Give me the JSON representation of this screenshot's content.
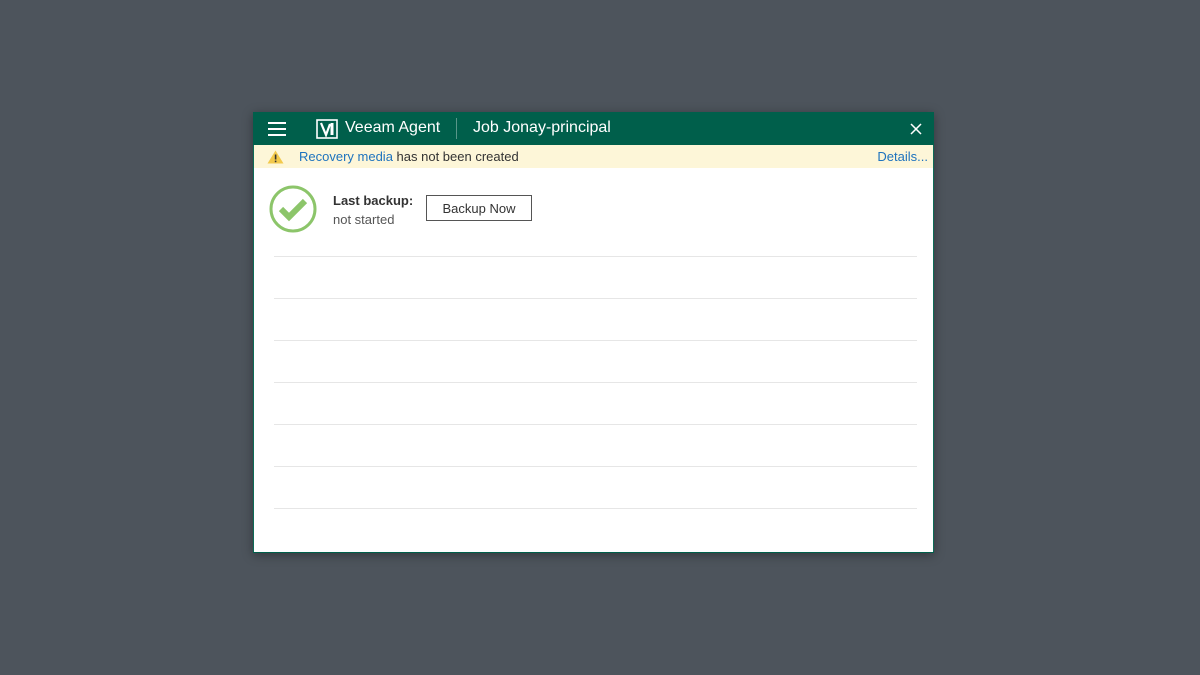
{
  "titlebar": {
    "app_name": "Veeam Agent",
    "job_title": "Job Jonay-principal",
    "background": "#005f4b"
  },
  "icons": {
    "menu": "hamburger-menu-icon",
    "logo": "veeam-logo-icon",
    "close": "close-icon",
    "warning": "warning-triangle-icon",
    "status": "success-check-icon"
  },
  "warning": {
    "link_text": "Recovery media",
    "message": " has not been created",
    "details_link": "Details...",
    "background": "#fdf6d8"
  },
  "status": {
    "label": "Last backup:",
    "value": "not started",
    "backup_button": "Backup Now",
    "success_color": "#8cc56a"
  },
  "history_rows": [
    "",
    "",
    "",
    "",
    "",
    ""
  ]
}
